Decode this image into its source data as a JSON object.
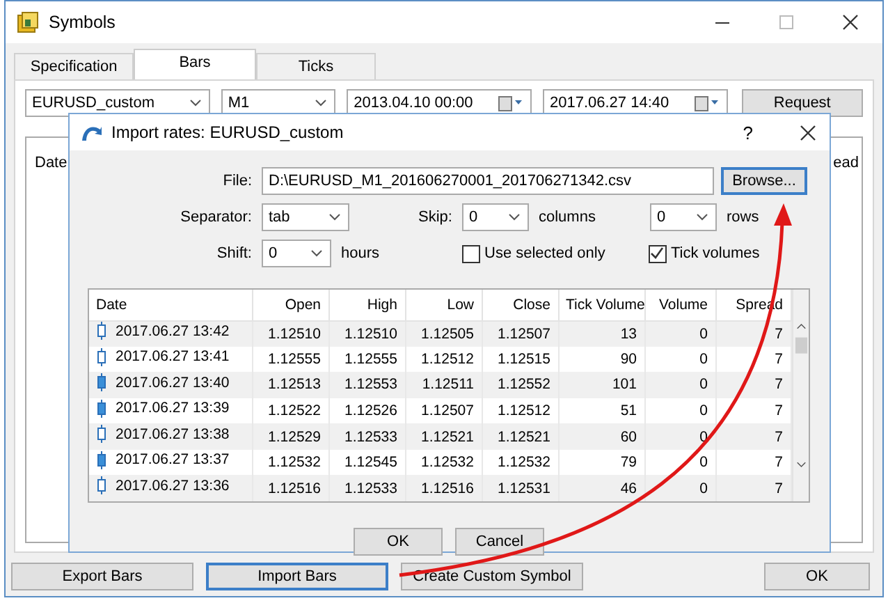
{
  "window": {
    "title": "Symbols"
  },
  "tabs": [
    {
      "label": "Specification",
      "selected": false
    },
    {
      "label": "Bars",
      "selected": true
    },
    {
      "label": "Ticks",
      "selected": false
    }
  ],
  "toolbar": {
    "symbol": "EURUSD_custom",
    "timeframe": "M1",
    "date_from": "2013.04.10 00:00",
    "date_to": "2017.06.27 14:40",
    "request_button": "Request"
  },
  "bars_table": {
    "columns": [
      "Date",
      "ead"
    ]
  },
  "buttons": [
    {
      "label": "Export Bars",
      "focused": false
    },
    {
      "label": "Import Bars",
      "focused": true
    },
    {
      "label": "Create Custom Symbol",
      "focused": false
    },
    {
      "label": "OK",
      "focused": false
    }
  ],
  "dialog": {
    "title": "Import rates: EURUSD_custom",
    "help": "?",
    "file_label": "File:",
    "file": "D:\\EURUSD_M1_201606270001_201706271342.csv",
    "browse_button": "Browse...",
    "separator_label": "Separator:",
    "separator": "tab",
    "skip_label": "Skip:",
    "skip_columns": "0",
    "columns_label": "columns",
    "skip_rows": "0",
    "rows_label": "rows",
    "shift_label": "Shift:",
    "shift": "0",
    "hours_label": "hours",
    "use_selected_only": {
      "label": "Use selected only",
      "checked": false
    },
    "tick_volumes": {
      "label": "Tick volumes",
      "checked": true
    },
    "table": {
      "columns": [
        "Date",
        "Open",
        "High",
        "Low",
        "Close",
        "Tick Volume",
        "Volume",
        "Spread"
      ],
      "rows": [
        {
          "kind": "hollow",
          "cells": [
            "2017.06.27 13:42",
            "1.12510",
            "1.12510",
            "1.12505",
            "1.12507",
            "13",
            "0",
            "7"
          ]
        },
        {
          "kind": "hollow",
          "cells": [
            "2017.06.27 13:41",
            "1.12555",
            "1.12555",
            "1.12512",
            "1.12515",
            "90",
            "0",
            "7"
          ]
        },
        {
          "kind": "filled",
          "cells": [
            "2017.06.27 13:40",
            "1.12513",
            "1.12553",
            "1.12511",
            "1.12552",
            "101",
            "0",
            "7"
          ]
        },
        {
          "kind": "filled",
          "cells": [
            "2017.06.27 13:39",
            "1.12522",
            "1.12526",
            "1.12507",
            "1.12512",
            "51",
            "0",
            "7"
          ]
        },
        {
          "kind": "hollow",
          "cells": [
            "2017.06.27 13:38",
            "1.12529",
            "1.12533",
            "1.12521",
            "1.12521",
            "60",
            "0",
            "7"
          ]
        },
        {
          "kind": "filled",
          "cells": [
            "2017.06.27 13:37",
            "1.12532",
            "1.12545",
            "1.12532",
            "1.12532",
            "79",
            "0",
            "7"
          ]
        },
        {
          "kind": "hollow",
          "cells": [
            "2017.06.27 13:36",
            "1.12516",
            "1.12533",
            "1.12516",
            "1.12531",
            "46",
            "0",
            "7"
          ]
        }
      ]
    },
    "buttons": [
      "OK",
      "Cancel"
    ]
  }
}
